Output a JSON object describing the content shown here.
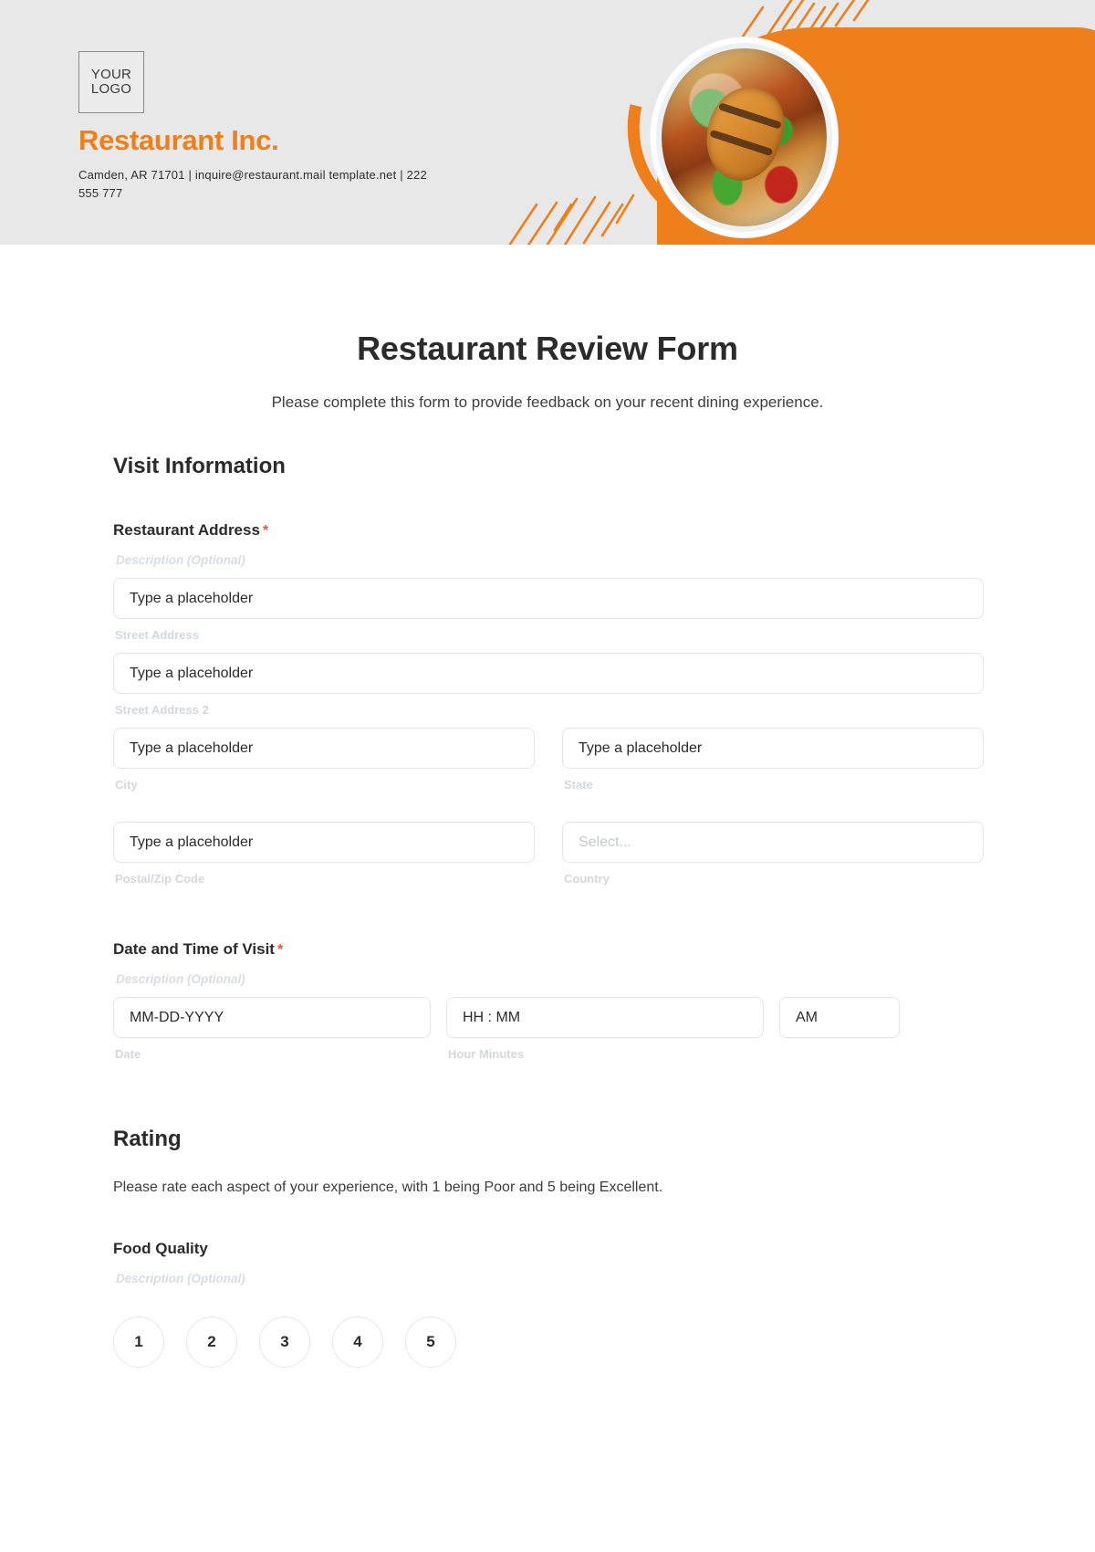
{
  "header": {
    "logo_line1": "YOUR",
    "logo_line2": "LOGO",
    "brand_name": "Restaurant Inc.",
    "contact": "Camden, AR 71701 | inquire@restaurant.mail template.net | 222 555 777"
  },
  "form": {
    "title": "Restaurant Review Form",
    "subtitle": "Please complete this form to provide feedback on your recent dining experience."
  },
  "visit_section": {
    "heading": "Visit Information",
    "address": {
      "label": "Restaurant Address",
      "required_mark": "*",
      "description": "Description (Optional)",
      "street1_placeholder": "Type a placeholder",
      "street1_sublabel": "Street Address",
      "street2_placeholder": "Type a placeholder",
      "street2_sublabel": "Street Address 2",
      "city_placeholder": "Type a placeholder",
      "city_sublabel": "City",
      "state_placeholder": "Type a placeholder",
      "state_sublabel": "State",
      "postal_placeholder": "Type a placeholder",
      "postal_sublabel": "Postal/Zip Code",
      "country_placeholder": "Select...",
      "country_sublabel": "Country"
    },
    "datetime": {
      "label": "Date and Time of Visit",
      "required_mark": "*",
      "description": "Description (Optional)",
      "date_placeholder": "MM-DD-YYYY",
      "date_sublabel": "Date",
      "time_placeholder": "HH : MM",
      "time_sublabel": "Hour Minutes",
      "ampm_value": "AM"
    }
  },
  "rating_section": {
    "heading": "Rating",
    "note": "Please rate each aspect of your experience, with 1 being Poor and 5 being Excellent.",
    "food_quality": {
      "label": "Food Quality",
      "description": "Description (Optional)",
      "scale": [
        "1",
        "2",
        "3",
        "4",
        "5"
      ]
    }
  },
  "colors": {
    "brand_orange": "#ef7f1a",
    "header_bg": "#e8e8e8",
    "required_red": "#f4533a",
    "text_dark": "#2b2b2b",
    "muted_label": "#d3d8df"
  }
}
